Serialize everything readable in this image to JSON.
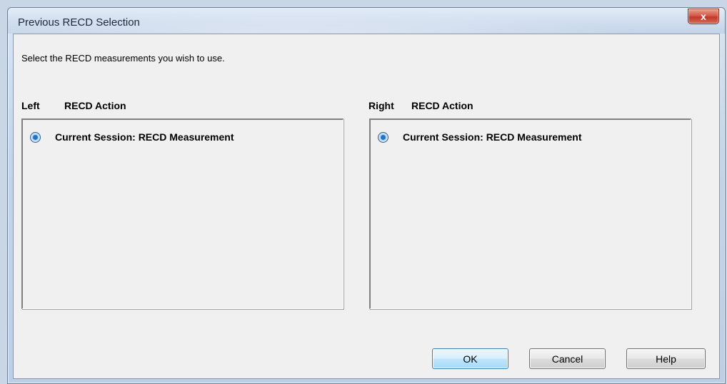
{
  "window": {
    "title": "Previous RECD Selection",
    "close_label": "x"
  },
  "instruction": "Select the RECD measurements you wish to use.",
  "left": {
    "side_label": "Left",
    "action_label": "RECD Action",
    "option_label": "Current Session: RECD Measurement",
    "selected": true
  },
  "right": {
    "side_label": "Right",
    "action_label": "RECD Action",
    "option_label": "Current Session: RECD Measurement",
    "selected": true
  },
  "buttons": {
    "ok": "OK",
    "cancel": "Cancel",
    "help": "Help"
  },
  "colors": {
    "radio_accent": "#1f74c7",
    "close_red": "#c0392b",
    "default_button": "#a7d9f5"
  }
}
